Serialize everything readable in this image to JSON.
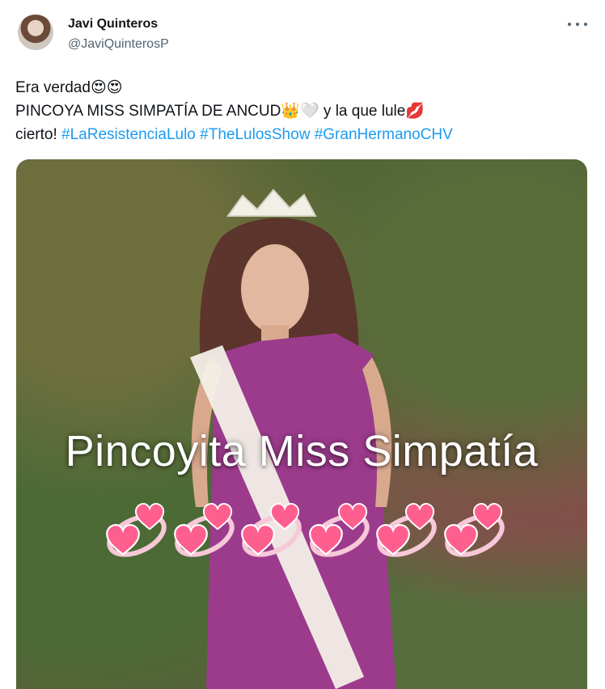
{
  "author": {
    "name": "Javi Quinteros",
    "handle": "@JaviQuinterosP"
  },
  "tweet": {
    "line1": "Era verdad😍😍",
    "line2": "PINCOYA MISS SIMPATÍA DE ANCUD👑🤍 y la que lule💋",
    "line3_prefix": "cierto! ",
    "hashtags": [
      "#LaResistenciaLulo",
      "#TheLulosShow",
      "#GranHermanoCHV"
    ]
  },
  "media": {
    "overlay_text": "Pincoyita Miss Simpatía",
    "hearts_count": 6
  },
  "colors": {
    "link": "#1d9bf0",
    "text": "#0f1419",
    "secondary": "#536471",
    "heart": "#ff5f8f"
  },
  "icons": {
    "more": "more-horizontal-icon",
    "heart_sticker": "revolving-hearts-icon"
  }
}
